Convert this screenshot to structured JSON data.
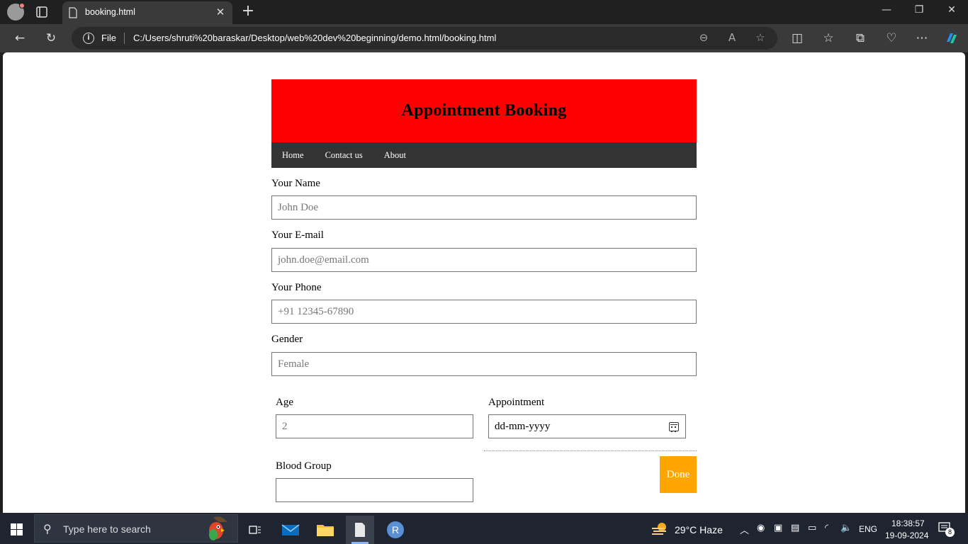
{
  "browser": {
    "tab_title": "booking.html",
    "address_scheme": "File",
    "address_url": "C:/Users/shruti%20baraskar/Desktop/web%20dev%20beginning/demo.html/booking.html"
  },
  "page": {
    "heading": "Appointment Booking",
    "nav": [
      "Home",
      "Contact us",
      "About"
    ],
    "name_label": "Your Name",
    "name_placeholder": "John Doe",
    "email_label": "Your E-mail",
    "email_placeholder": "john.doe@email.com",
    "phone_label": "Your Phone",
    "phone_placeholder": "+91 12345-67890",
    "gender_label": "Gender",
    "gender_placeholder": "Female",
    "age_label": "Age",
    "age_placeholder": "2",
    "appointment_label": "Appointment",
    "appointment_placeholder": "dd-mm-yyyy",
    "blood_label": "Blood Group",
    "blood_value": "",
    "done_label": "Done"
  },
  "taskbar": {
    "search_placeholder": "Type here to search",
    "weather": "29°C  Haze",
    "language": "ENG",
    "time": "18:38:57",
    "date": "19-09-2024",
    "notifications": "8",
    "app_letter": "R"
  },
  "colors": {
    "header_bg": "#ff0000",
    "nav_bg": "#333333",
    "done_bg": "#ffa500"
  }
}
